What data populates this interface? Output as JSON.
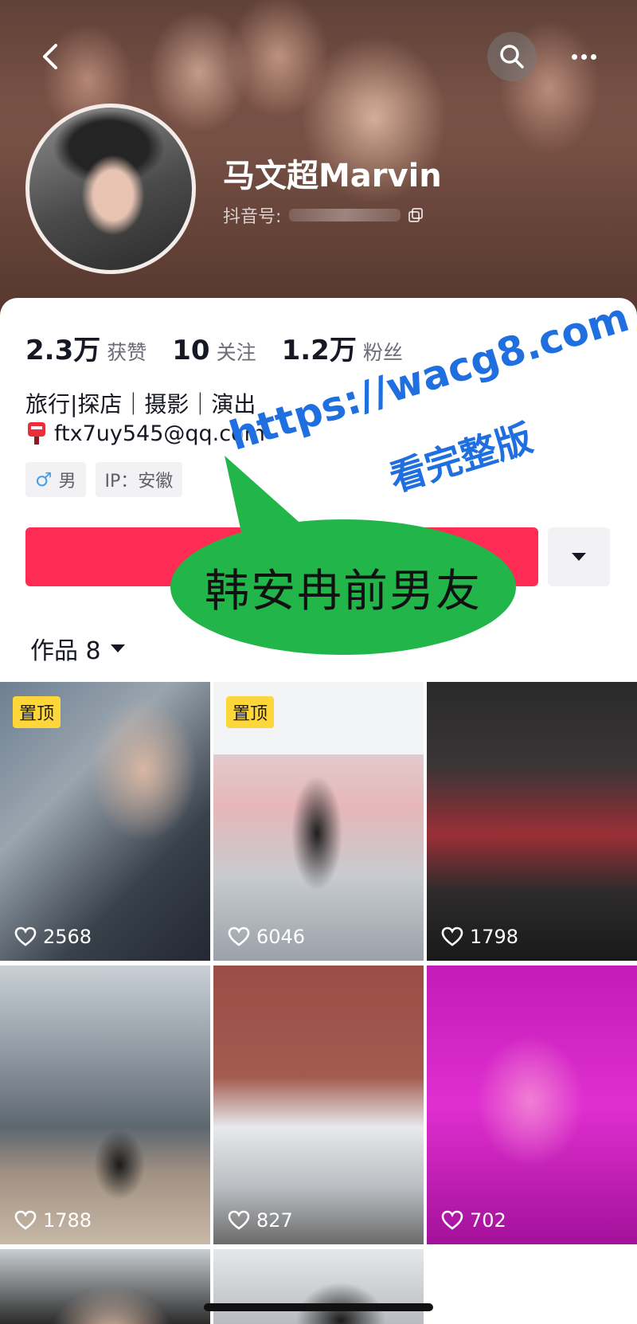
{
  "profile": {
    "name": "马文超Marvin",
    "douyin_id_label": "抖音号:",
    "stats": [
      {
        "value": "2.3万",
        "label": "获赞"
      },
      {
        "value": "10",
        "label": "关注"
      },
      {
        "value": "1.2万",
        "label": "粉丝"
      }
    ],
    "bio": "旅行|探店｜摄影｜演出",
    "email": "ftx7uy545@qq.com",
    "tags": [
      {
        "icon": "male-icon",
        "symbol": "♂",
        "label": "男"
      },
      {
        "label": "IP：安徽"
      }
    ]
  },
  "works_tab": {
    "label": "作品 8"
  },
  "annotation": {
    "text": "韩安冉前男友",
    "color": "#22b54a"
  },
  "watermark": {
    "url": "https://wacg8.com",
    "subtitle": "看完整版",
    "color": "#1f6fe0"
  },
  "videos": [
    {
      "pinned": true,
      "pin_label": "置顶",
      "likes": "2568"
    },
    {
      "pinned": true,
      "pin_label": "置顶",
      "likes": "6046"
    },
    {
      "pinned": false,
      "likes": "1798"
    },
    {
      "pinned": false,
      "likes": "1788"
    },
    {
      "pinned": false,
      "likes": "827"
    },
    {
      "pinned": false,
      "likes": "702"
    }
  ],
  "colors": {
    "follow_button": "#fe2c55",
    "pin_badge": "#fdd73a"
  }
}
